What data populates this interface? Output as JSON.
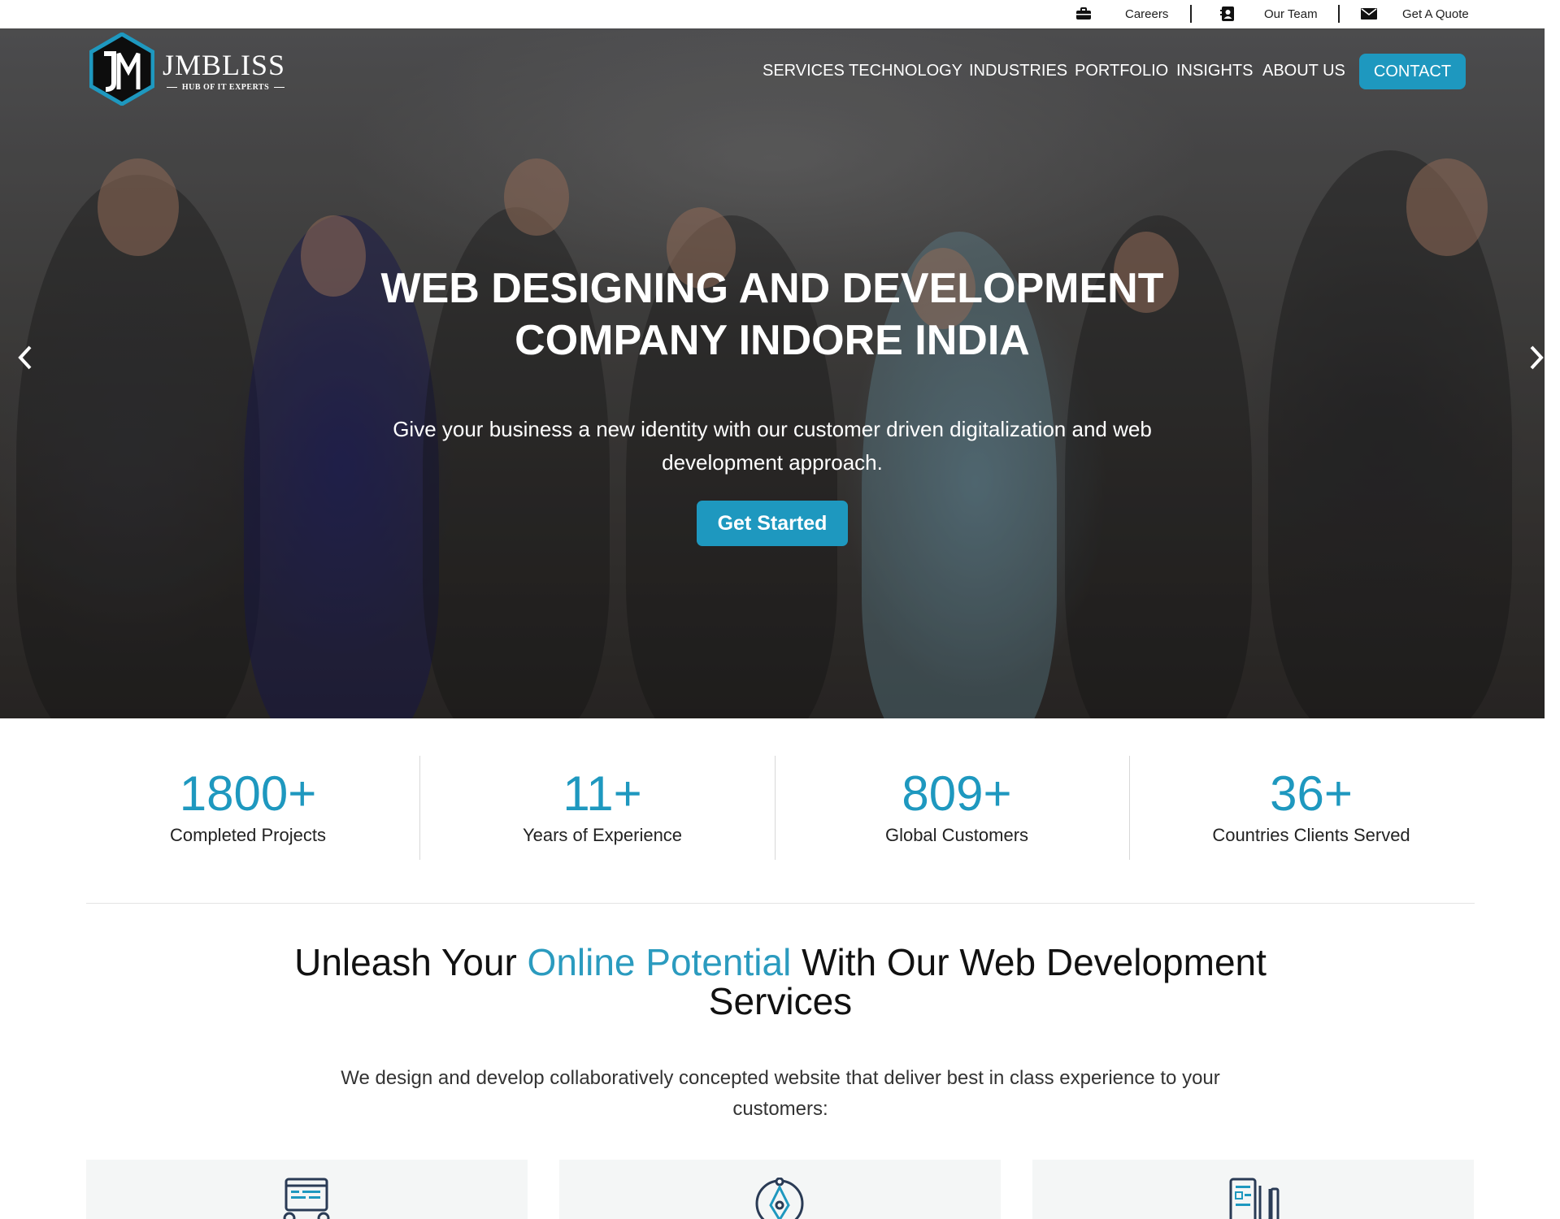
{
  "topbar": {
    "careers": "Careers",
    "our_team": "Our Team",
    "get_quote": "Get A Quote"
  },
  "brand": {
    "name": "JMBLISS",
    "tagline": "HUB OF IT EXPERTS",
    "accent": "#1e98bf"
  },
  "nav": {
    "items": [
      "SERVICES",
      "TECHNOLOGY",
      "INDUSTRIES",
      "PORTFOLIO",
      "INSIGHTS",
      "ABOUT US"
    ],
    "contact": "CONTACT"
  },
  "hero": {
    "title_line1": "WEB DESIGNING AND DEVELOPMENT",
    "title_line2": "COMPANY INDORE INDIA",
    "subtitle": "Give your business a new identity with our customer driven digitalization and web development approach.",
    "cta": "Get Started",
    "prev_icon": "chevron-left-icon",
    "next_icon": "chevron-right-icon"
  },
  "stats": [
    {
      "number": "1800+",
      "label": "Completed Projects"
    },
    {
      "number": "11+",
      "label": "Years of Experience"
    },
    {
      "number": "809+",
      "label": "Global Customers"
    },
    {
      "number": "36+",
      "label": "Countries Clients Served"
    }
  ],
  "section": {
    "title_pre": "Unleash Your ",
    "title_accent": "Online Potential",
    "title_post": " With Our Web Development Services",
    "text": "We design and develop collaboratively concepted website that deliver best in class experience to your customers:"
  },
  "cards": [
    {
      "icon": "web-code-icon"
    },
    {
      "icon": "pen-tool-icon"
    },
    {
      "icon": "mobile-design-icon"
    }
  ]
}
